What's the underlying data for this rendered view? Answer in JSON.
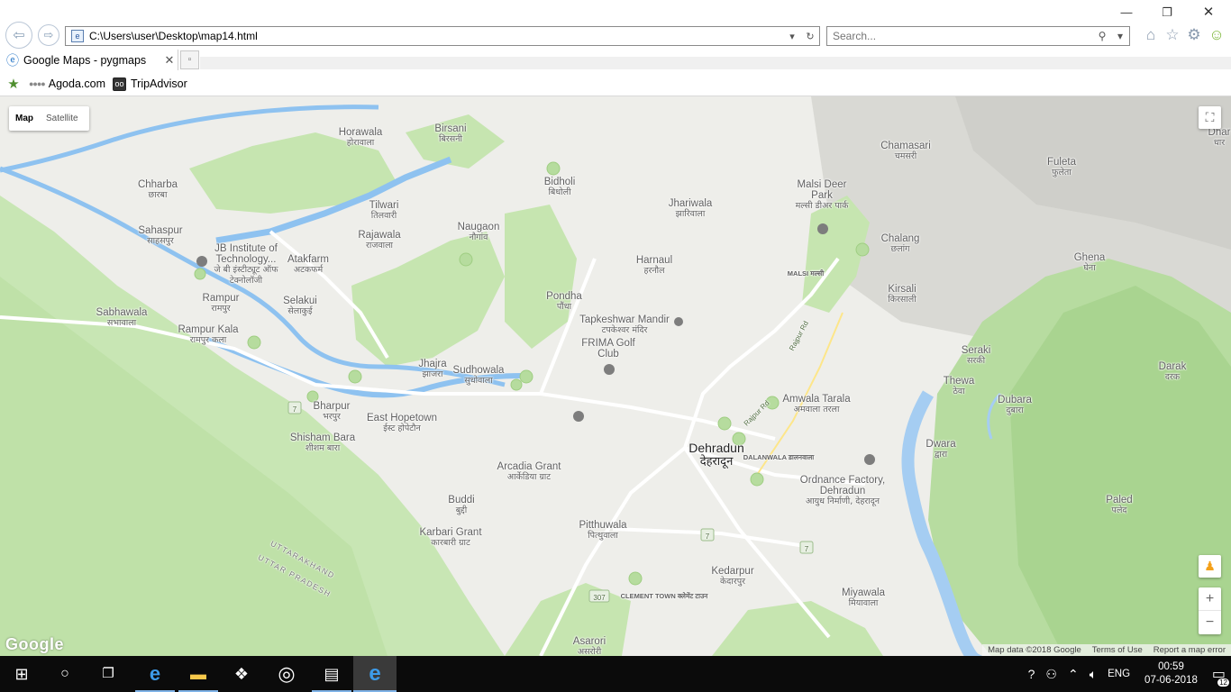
{
  "window": {
    "controls": {
      "minimize": "—",
      "maximize": "❐",
      "close": "✕"
    }
  },
  "toolbar": {
    "back_icon": "arrow-left-icon",
    "forward_icon": "arrow-right-icon",
    "address": "C:\\Users\\user\\Desktop\\map14.html",
    "search_placeholder": "Search...",
    "icons": [
      "home-icon",
      "star-icon",
      "gear-icon",
      "smiley-icon"
    ]
  },
  "tabs": [
    {
      "label": "Google Maps - pygmaps",
      "active": true
    }
  ],
  "favorites": [
    {
      "label": "Agoda.com"
    },
    {
      "label": "TripAdvisor"
    }
  ],
  "map": {
    "type_control": {
      "map": "Map",
      "satellite": "Satellite"
    },
    "zoom": {
      "in": "+",
      "out": "−"
    },
    "logo": "Google",
    "footer": {
      "data": "Map data ©2018 Google",
      "terms": "Terms of Use",
      "report": "Report a map error"
    },
    "places": [
      {
        "en": "Horawala",
        "hi": "होरावाला"
      },
      {
        "en": "Birsani",
        "hi": "बिरसनी"
      },
      {
        "en": "Chharba",
        "hi": "छारबा"
      },
      {
        "en": "Tilwari",
        "hi": "तिलवारी"
      },
      {
        "en": "Naugaon",
        "hi": "नौगांव"
      },
      {
        "en": "Bidholi",
        "hi": "बिधोली"
      },
      {
        "en": "Jhariwala",
        "hi": "झारिवाला"
      },
      {
        "en": "Malsi Deer Park",
        "hi": "मल्सी डीअर पार्क"
      },
      {
        "en": "Chamasari",
        "hi": "चमसरी"
      },
      {
        "en": "Fuleta",
        "hi": "फुलेता"
      },
      {
        "en": "Sahaspur",
        "hi": "साहसपुर"
      },
      {
        "en": "Rajawala",
        "hi": "राजवाला"
      },
      {
        "en": "JB Institute of Technology...",
        "hi": "जे बी इंस्टीट्यूट ऑफ टेक्नोलॉजी"
      },
      {
        "en": "Atakfarm",
        "hi": "अटकफर्म"
      },
      {
        "en": "Harnaul",
        "hi": "हरनौल"
      },
      {
        "en": "Chalang",
        "hi": "छलांग"
      },
      {
        "en": "Ghena",
        "hi": "घेना"
      },
      {
        "en": "Rampur",
        "hi": "रामपुर"
      },
      {
        "en": "Selakui",
        "hi": "सेलाकुई"
      },
      {
        "en": "Pondha",
        "hi": "पौंधा"
      },
      {
        "en": "Kirsali",
        "hi": "किरसाली"
      },
      {
        "en": "Sabhawala",
        "hi": "सभावाला"
      },
      {
        "en": "Tapkeshwar Mandir",
        "hi": "टपकेश्वर मंदिर"
      },
      {
        "en": "Rampur Kala",
        "hi": "रामपुर कला"
      },
      {
        "en": "FRIMA Golf Club",
        "hi": ""
      },
      {
        "en": "Seraki",
        "hi": "सरकी"
      },
      {
        "en": "Jhajra",
        "hi": "झाजरा"
      },
      {
        "en": "Sudhowala",
        "hi": "सुधोवाला"
      },
      {
        "en": "Darak",
        "hi": "दरक"
      },
      {
        "en": "Thewa",
        "hi": "ठेवा"
      },
      {
        "en": "Amwala Tarala",
        "hi": "अमवाला तरला"
      },
      {
        "en": "Dubara",
        "hi": "दुबारा"
      },
      {
        "en": "Bharpur",
        "hi": "भरपुर"
      },
      {
        "en": "East Hopetown",
        "hi": "ईस्ट होपेटौन"
      },
      {
        "en": "Shisham Bara",
        "hi": "शीशम बारा"
      },
      {
        "en": "Dehradun",
        "hi": "देहरादून"
      },
      {
        "en": "Dwara",
        "hi": "द्वारा"
      },
      {
        "en": "Arcadia Grant",
        "hi": "आर्केडिया ग्राट"
      },
      {
        "en": "Ordnance Factory, Dehradun",
        "hi": "आयुध निर्माणी, देहरादून"
      },
      {
        "en": "Buddi",
        "hi": "बुद्दी"
      },
      {
        "en": "Paled",
        "hi": "पलेद"
      },
      {
        "en": "Pitthuwala",
        "hi": "पित्थुवाला"
      },
      {
        "en": "Karbari Grant",
        "hi": "कारबारी ग्राट"
      },
      {
        "en": "Kedarpur",
        "hi": "केदारपुर"
      },
      {
        "en": "Miyawala",
        "hi": "मियावाला"
      },
      {
        "en": "Asarori",
        "hi": "असरोरी"
      },
      {
        "en": "Dhar",
        "hi": "धार"
      }
    ],
    "small_labels": [
      "MALSI मल्सी",
      "DALANWALA डालनवाला",
      "CLEMENT TOWN क्लेमेंट टाउन"
    ],
    "road_labels": [
      "Rajpur Rd",
      "Rajpur Rd"
    ],
    "route_shields": [
      "7",
      "7",
      "7",
      "307"
    ],
    "border_labels": [
      "UTTARAKHAND",
      "UTTAR PRADESH"
    ]
  },
  "taskbar": {
    "apps": [
      "windows-icon",
      "cortana-icon",
      "task-view-icon",
      "edge-icon",
      "file-explorer-icon",
      "dropbox-icon",
      "media-player-icon",
      "notepad-icon",
      "ie-icon"
    ],
    "tray": {
      "lang": "ENG",
      "time": "00:59",
      "date": "07-06-2018",
      "notifications": "12"
    }
  }
}
